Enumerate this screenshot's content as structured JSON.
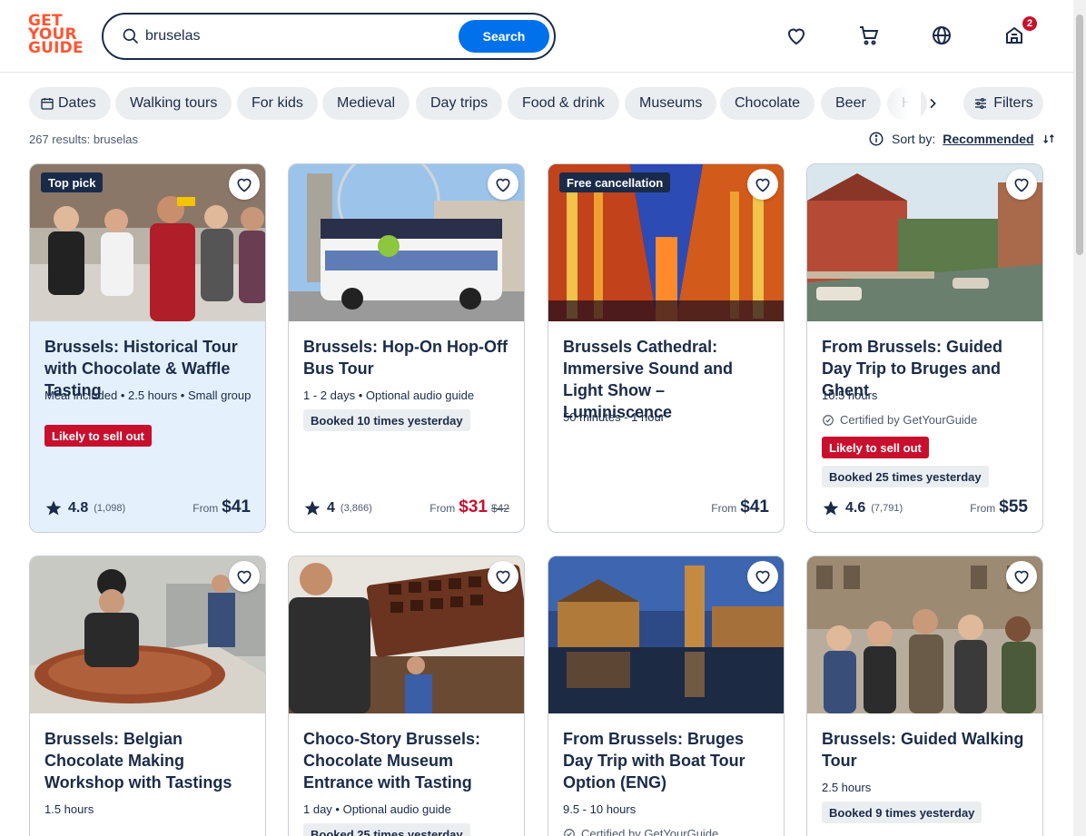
{
  "header": {
    "logo_lines": [
      "GET",
      "YOUR",
      "GUIDE"
    ],
    "search_value": "bruselas",
    "search_button": "Search",
    "cart_badge": "2"
  },
  "chips": [
    "Dates",
    "Walking tours",
    "For kids",
    "Medieval",
    "Day trips",
    "Food & drink",
    "Museums",
    "Chocolate",
    "Beer",
    "H"
  ],
  "filters_label": "Filters",
  "results_text": "267 results: bruselas",
  "sort": {
    "label": "Sort by:",
    "value": "Recommended"
  },
  "cards": [
    {
      "badge": "Top pick",
      "title": "Brussels: Historical Tour with Chocolate & Waffle Tasting",
      "meta": "Meal included • 2.5 hours • Small group",
      "tag_red": "Likely to sell out",
      "rating": "4.8",
      "rating_count": "(1,098)",
      "price_prefix": "From",
      "price": "$41"
    },
    {
      "title": "Brussels: Hop-On Hop-Off Bus Tour",
      "meta": "1 - 2 days • Optional audio guide",
      "tag_gray": "Booked 10 times yesterday",
      "rating": "4",
      "rating_count": "(3,866)",
      "price_prefix": "From",
      "price": "$31",
      "price_old": "$42"
    },
    {
      "badge": "Free cancellation",
      "title": "Brussels Cathedral: Immersive Sound and Light Show – Luminiscence",
      "meta": "50 minutes - 1 hour",
      "price_prefix": "From",
      "price": "$41"
    },
    {
      "title": "From Brussels: Guided Day Trip to Bruges and Ghent",
      "meta": "10.5 hours",
      "certified": "Certified by GetYourGuide",
      "tag_red": "Likely to sell out",
      "tag_gray": "Booked 25 times yesterday",
      "rating": "4.6",
      "rating_count": "(7,791)",
      "price_prefix": "From",
      "price": "$55"
    },
    {
      "title": "Brussels: Belgian Chocolate Making Workshop with Tastings",
      "meta": "1.5 hours"
    },
    {
      "title": "Choco-Story Brussels: Chocolate Museum Entrance with Tasting",
      "meta": "1 day • Optional audio guide",
      "tag_gray": "Booked 25 times yesterday"
    },
    {
      "title": "From Brussels: Bruges Day Trip with Boat Tour Option (ENG)",
      "meta": "9.5 - 10 hours",
      "certified": "Certified by GetYourGuide"
    },
    {
      "title": "Brussels: Guided Walking Tour",
      "meta": "2.5 hours",
      "tag_gray": "Booked 9 times yesterday"
    }
  ],
  "colors": {
    "brand": "#ff5533",
    "primary": "#0071eb",
    "ink": "#1a2b49",
    "alert": "#c8102e",
    "highlight": "#e4f0fc"
  }
}
